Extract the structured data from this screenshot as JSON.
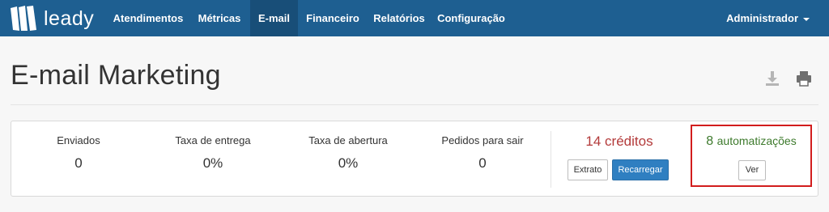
{
  "brand": {
    "name": "leady"
  },
  "nav": {
    "items": [
      {
        "label": "Atendimentos"
      },
      {
        "label": "Métricas"
      },
      {
        "label": "E-mail"
      },
      {
        "label": "Financeiro"
      },
      {
        "label": "Relatórios"
      },
      {
        "label": "Configuração"
      }
    ],
    "active_index": 2,
    "user_label": "Administrador"
  },
  "page": {
    "title": "E-mail Marketing",
    "tools": [
      "download-icon",
      "print-icon"
    ]
  },
  "stats": [
    {
      "label": "Enviados",
      "value": "0"
    },
    {
      "label": "Taxa de entrega",
      "value": "0%"
    },
    {
      "label": "Taxa de abertura",
      "value": "0%"
    },
    {
      "label": "Pedidos para sair",
      "value": "0"
    }
  ],
  "credits": {
    "text": "14 créditos",
    "statement_label": "Extrato",
    "recharge_label": "Recarregar"
  },
  "automations": {
    "count": "8",
    "label": "automatizações",
    "view_label": "Ver"
  },
  "colors": {
    "navbar": "#1e5f91",
    "nav_active": "#184e78",
    "credits_text": "#b33a3a",
    "automations_text": "#3d7a2c",
    "primary_button": "#2f7fc1",
    "highlight_border": "#d21d1d"
  }
}
